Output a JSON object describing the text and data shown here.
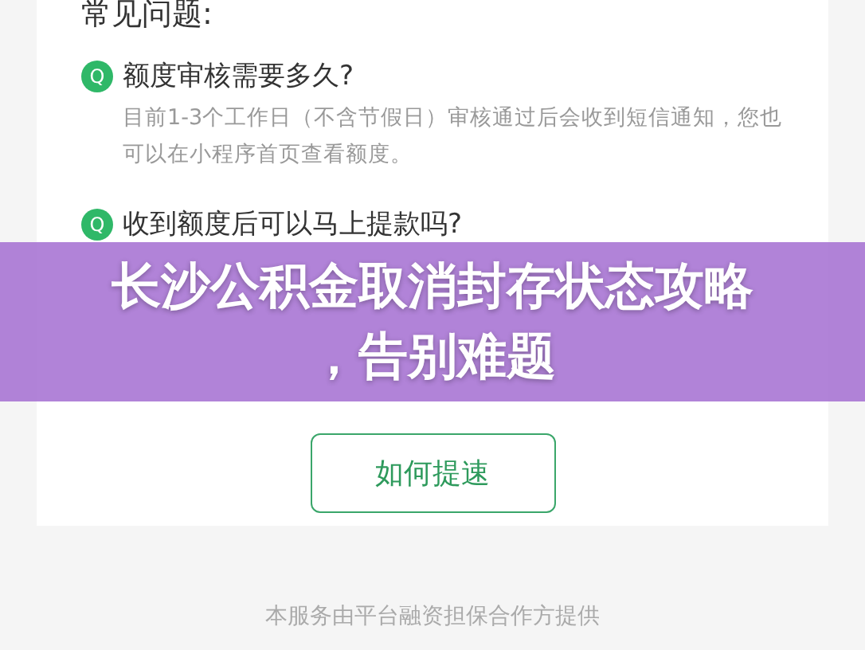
{
  "section_title": "常见问题:",
  "faq": [
    {
      "question": "额度审核需要多久?",
      "answer": "目前1-3个工作日（不含节假日）审核通过后会收到短信通知，您也可以在小程序首页查看额度。",
      "badge": "Q"
    },
    {
      "question": "收到额度后可以马上提款吗?",
      "badge": "Q"
    }
  ],
  "button": "如何提速",
  "banner": {
    "title": "长沙公积金取消封存状态攻略，告别难题"
  },
  "footer": "本服务由平台融资担保合作方提供"
}
